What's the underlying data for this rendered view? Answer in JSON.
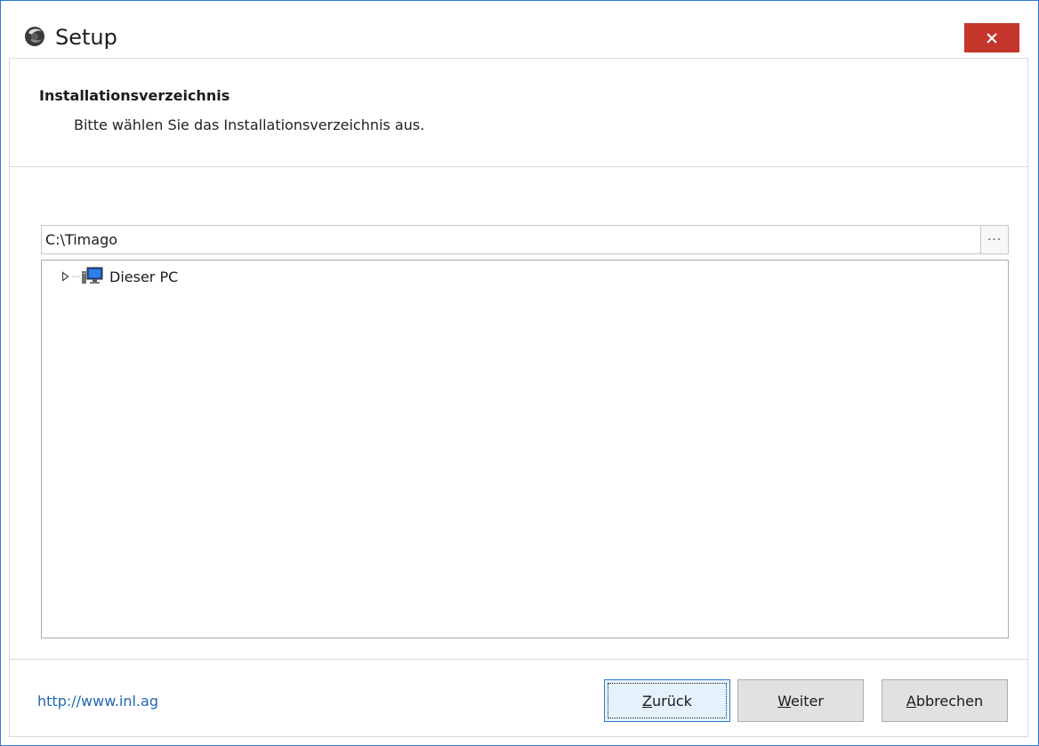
{
  "window": {
    "title": "Setup",
    "close_label": "×"
  },
  "header": {
    "title": "Installationsverzeichnis",
    "subtitle": "Bitte wählen Sie das Installationsverzeichnis aus."
  },
  "path": {
    "value": "C:\\Timago",
    "browse_label": "···"
  },
  "tree": {
    "items": [
      {
        "label": "Dieser PC",
        "icon": "computer-icon",
        "expanded": false
      }
    ]
  },
  "footer": {
    "link": "http://www.inl.ag",
    "back_label": {
      "mnemonic": "Z",
      "rest": "urück"
    },
    "next_label": {
      "mnemonic": "W",
      "rest": "eiter"
    },
    "cancel_label": {
      "mnemonic": "A",
      "rest": "bbrechen"
    }
  },
  "colors": {
    "close_button": "#c4352b",
    "window_border": "#2b79d2",
    "link": "#2267b5"
  }
}
